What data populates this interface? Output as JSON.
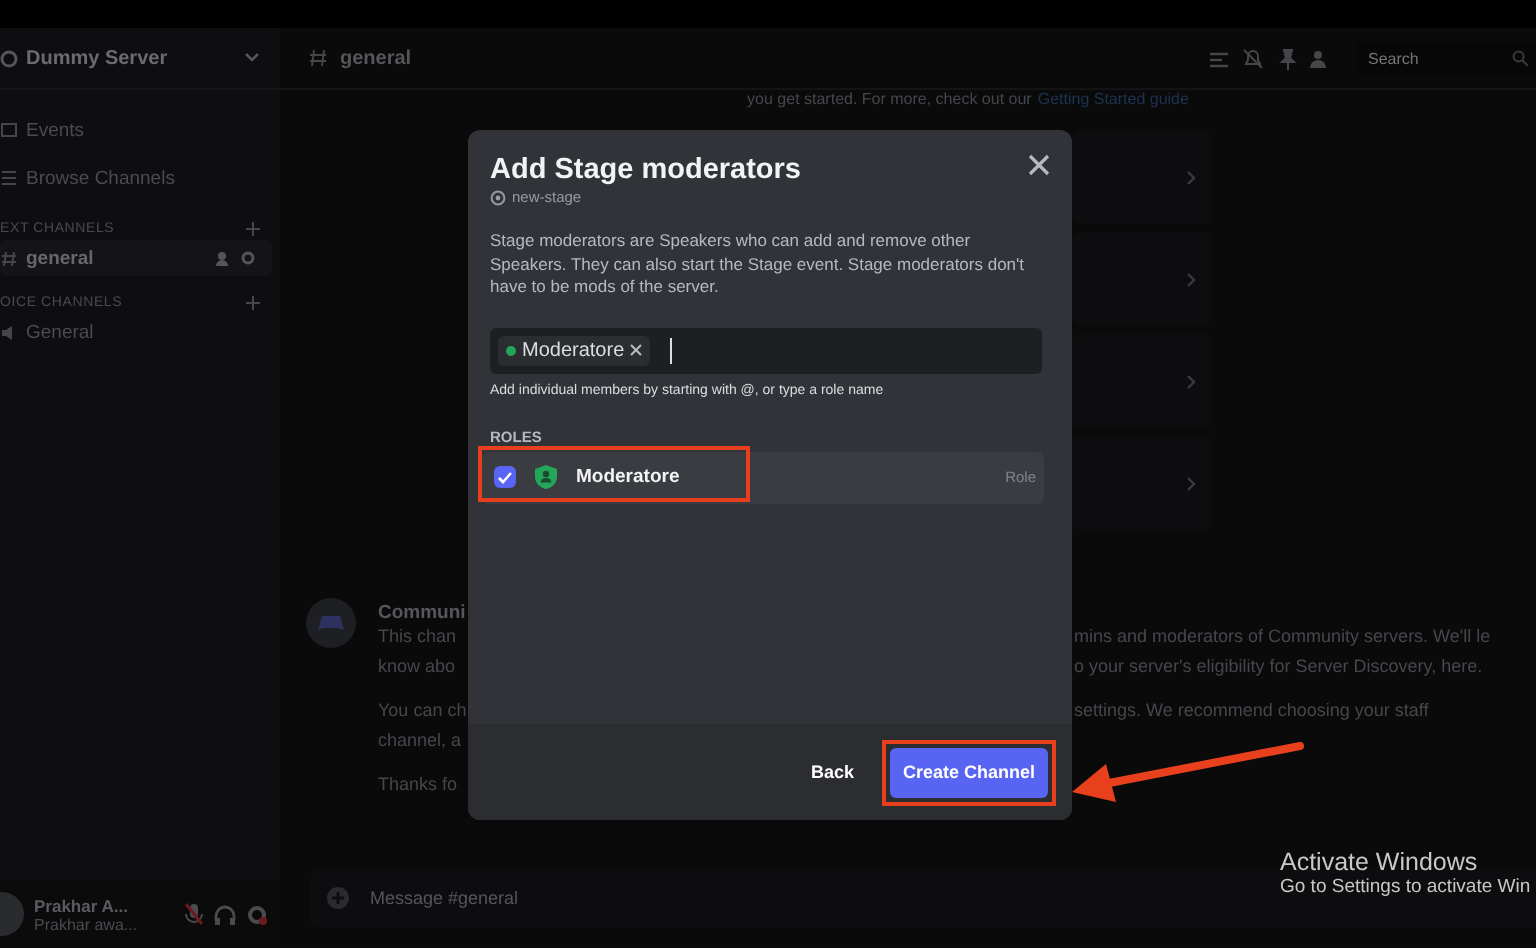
{
  "sidebar": {
    "server_name": "Dummy Server",
    "nav": [
      {
        "label": "Events",
        "kind": "events"
      },
      {
        "label": "Browse Channels",
        "kind": "browse"
      }
    ],
    "categories": [
      {
        "label": "EXT CHANNELS",
        "channels": [
          {
            "name": "general",
            "kind": "text",
            "selected": true
          }
        ]
      },
      {
        "label": "OICE CHANNELS",
        "channels": [
          {
            "name": "General",
            "kind": "voice",
            "selected": false
          }
        ]
      }
    ]
  },
  "user_panel": {
    "name": "Prakhar A...",
    "status": "Prakhar awa...",
    "muted": true
  },
  "header": {
    "channel": "general",
    "search": {
      "placeholder": "Search"
    }
  },
  "banner": {
    "text": "you get started. For more, check out our",
    "link": "Getting Started guide"
  },
  "message": {
    "author": "Communi",
    "paragraphs": [
      {
        "left": [
          "This chan",
          "know abo"
        ],
        "right": [
          "mins and moderators of Community servers. We'll le",
          "o your server's eligibility for Server Discovery, here."
        ]
      },
      {
        "left": [
          "You can ch",
          "channel, a"
        ],
        "right": [
          "settings. We recommend choosing your staff"
        ]
      },
      {
        "left": [
          "Thanks fo"
        ]
      }
    ]
  },
  "composer": {
    "placeholder": "Message #general"
  },
  "modal": {
    "title": "Add Stage moderators",
    "channel": "new-stage",
    "description": "Stage moderators are Speakers who can add and remove other Speakers. They can also start the Stage event. Stage moderators don't have to be mods of the server.",
    "chips": [
      {
        "label": "Moderatore",
        "color": "#23a55a"
      }
    ],
    "hint": "Add individual members by starting with @, or type a role name",
    "section": "ROLES",
    "roles": [
      {
        "name": "Moderatore",
        "type": "Role",
        "checked": true,
        "highlighted": true
      }
    ],
    "back": "Back",
    "create": {
      "label": "Create Channel",
      "highlighted": true
    }
  },
  "os_notice": {
    "title": "Activate Windows",
    "text": "Go to Settings to activate Win"
  }
}
